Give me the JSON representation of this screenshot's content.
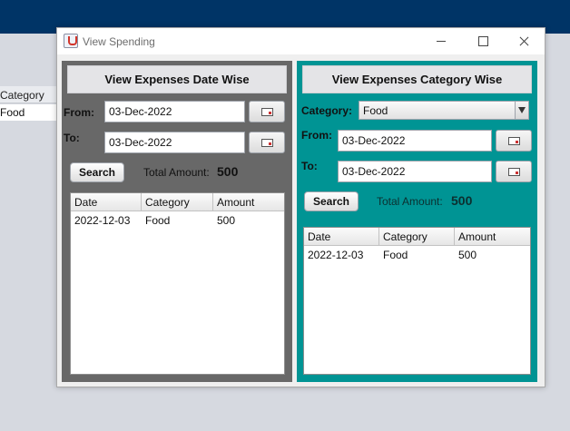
{
  "background": {
    "column_header": "Category",
    "cell": "Food"
  },
  "window": {
    "title": "View Spending",
    "icon": "java-icon"
  },
  "date_panel": {
    "title": "View Expenses Date Wise",
    "from_label": "From:",
    "from_value": "03-Dec-2022",
    "to_label": "To:",
    "to_value": "03-Dec-2022",
    "search_label": "Search",
    "total_label": "Total Amount:",
    "total_value": "500",
    "table": {
      "headers": [
        "Date",
        "Category",
        "Amount"
      ],
      "rows": [
        [
          "2022-12-03",
          "Food",
          "500"
        ]
      ]
    }
  },
  "category_panel": {
    "title": "View Expenses Category Wise",
    "category_label": "Category:",
    "category_value": "Food",
    "from_label": "From:",
    "from_value": "03-Dec-2022",
    "to_label": "To:",
    "to_value": "03-Dec-2022",
    "search_label": "Search",
    "total_label": "Total Amount:",
    "total_value": "500",
    "table": {
      "headers": [
        "Date",
        "Category",
        "Amount"
      ],
      "rows": [
        [
          "2022-12-03",
          "Food",
          "500"
        ]
      ]
    }
  },
  "colors": {
    "left_panel": "#686868",
    "right_panel": "#009494",
    "header_bar": "#003466"
  }
}
